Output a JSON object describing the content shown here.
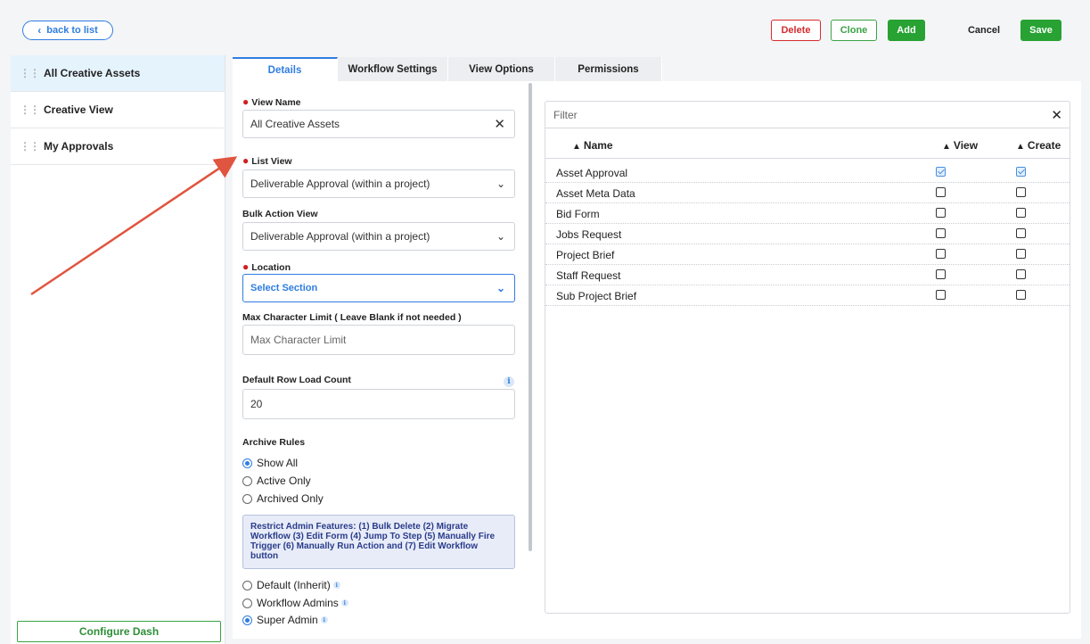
{
  "topbar": {
    "back_label": "back to list",
    "delete_label": "Delete",
    "clone_label": "Clone",
    "add_label": "Add",
    "cancel_label": "Cancel",
    "save_label": "Save"
  },
  "sidebar": {
    "items": [
      {
        "label": "All Creative Assets",
        "active": true
      },
      {
        "label": "Creative View",
        "active": false
      },
      {
        "label": "My Approvals",
        "active": false
      }
    ],
    "configure_label": "Configure Dash"
  },
  "tabs": [
    "Details",
    "Workflow Settings",
    "View Options",
    "Permissions"
  ],
  "form": {
    "view_name_label": "View Name",
    "view_name_value": "All Creative Assets",
    "list_view_label": "List View",
    "list_view_value": "Deliverable Approval (within a project)",
    "bulk_action_label": "Bulk Action View",
    "bulk_action_value": "Deliverable Approval (within a project)",
    "location_label": "Location",
    "location_value": "Select Section",
    "max_char_label": "Max Character Limit ( Leave Blank if not needed )",
    "max_char_placeholder": "Max Character Limit",
    "row_load_label": "Default Row Load Count",
    "row_load_value": "20",
    "archive_label": "Archive Rules",
    "archive_options": [
      "Show All",
      "Active Only",
      "Archived Only"
    ],
    "notice": "Restrict Admin Features: (1) Bulk Delete (2) Migrate Workflow (3) Edit Form (4) Jump To Step (5) Manually Fire Trigger (6) Manually Run Action and (7) Edit Workflow button",
    "admin_options": [
      "Default (Inherit)",
      "Workflow Admins",
      "Super Admin"
    ]
  },
  "permissions": {
    "filter_placeholder": "Filter",
    "columns": [
      "Name",
      "View",
      "Create"
    ],
    "rows": [
      {
        "name": "Asset Approval",
        "view": true,
        "create": true
      },
      {
        "name": "Asset Meta Data",
        "view": false,
        "create": false
      },
      {
        "name": "Bid Form",
        "view": false,
        "create": false
      },
      {
        "name": "Jobs Request",
        "view": false,
        "create": false
      },
      {
        "name": "Project Brief",
        "view": false,
        "create": false
      },
      {
        "name": "Staff Request",
        "view": false,
        "create": false
      },
      {
        "name": "Sub Project Brief",
        "view": false,
        "create": false
      }
    ]
  },
  "colors": {
    "accent": "#2f7de1",
    "success": "#27a233",
    "danger": "#d62c2c",
    "annotation_arrow": "#e0553f"
  }
}
